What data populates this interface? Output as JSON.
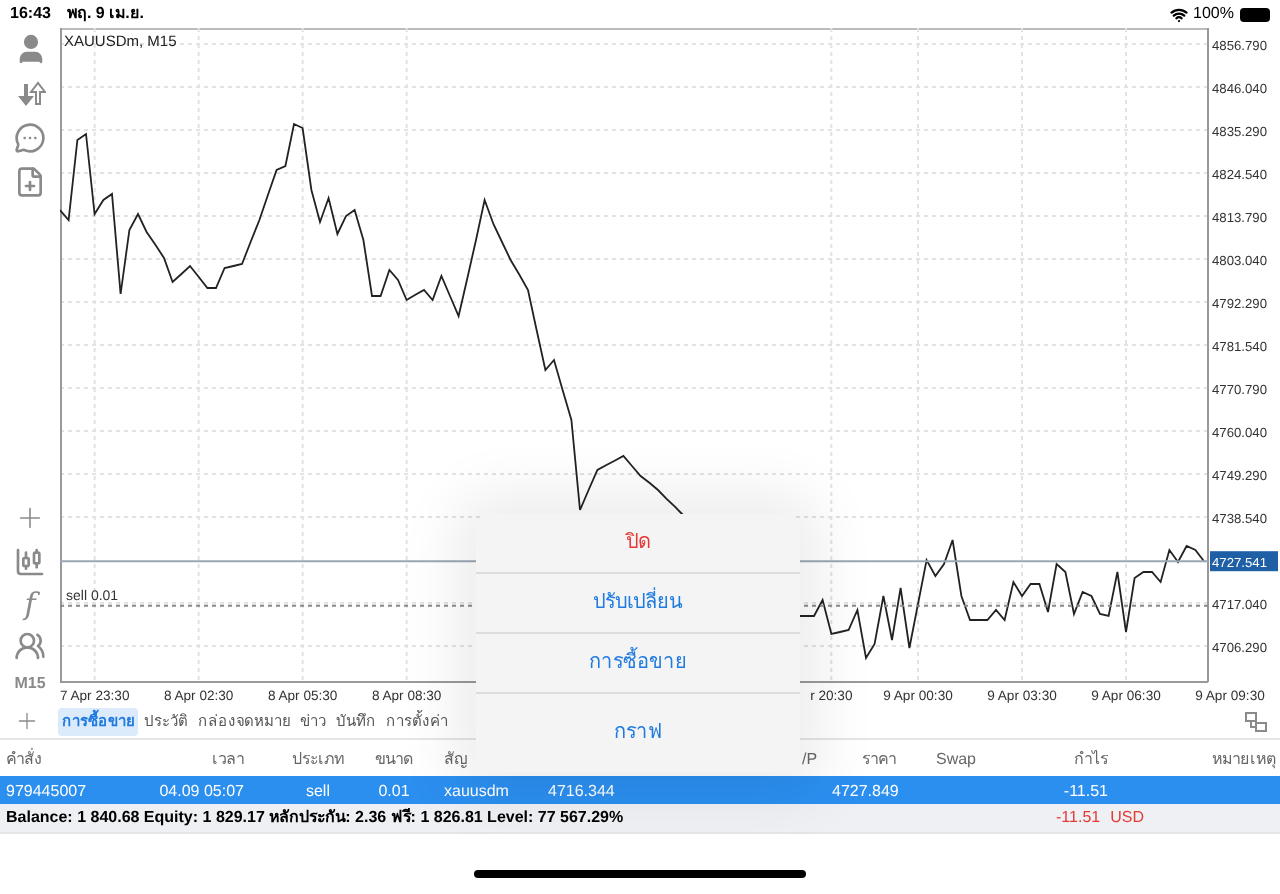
{
  "status_bar": {
    "time": "16:43",
    "date": "พฤ. 9 เม.ย.",
    "battery": "100%"
  },
  "toolbar": {
    "function_label": "f",
    "timeframe": "M15"
  },
  "chart": {
    "title": "XAUUSDm, M15",
    "chart_data": {
      "type": "line",
      "categories": [
        null,
        null,
        null,
        null,
        "7 Apr 23:30",
        null,
        null,
        null,
        null,
        null,
        null,
        null,
        null,
        null,
        null,
        null,
        "8 Apr 02:30",
        null,
        null,
        null,
        null,
        null,
        null,
        null,
        null,
        null,
        null,
        null,
        "8 Apr 05:30",
        null,
        null,
        null,
        null,
        null,
        null,
        null,
        null,
        null,
        null,
        null,
        "8 Apr 08:30",
        null,
        null,
        null,
        null,
        null,
        null,
        null,
        null,
        null,
        null,
        null,
        null,
        null,
        null,
        null,
        null,
        null,
        null,
        null,
        null,
        null,
        null,
        null,
        null,
        null,
        null,
        null,
        null,
        null,
        null,
        null,
        null,
        null,
        null,
        null,
        null,
        null,
        null,
        null,
        null,
        null,
        null,
        null,
        null,
        null,
        null,
        null,
        null,
        "r 20:30",
        null,
        null,
        null,
        null,
        null,
        null,
        null,
        null,
        null,
        "9 Apr 00:30",
        null,
        null,
        null,
        null,
        null,
        null,
        null,
        null,
        null,
        null,
        null,
        "9 Apr 03:30",
        null,
        null,
        null,
        null,
        null,
        null,
        null,
        null,
        null,
        null,
        null,
        "9 Apr 06:30",
        null,
        null,
        null,
        null,
        null,
        null,
        null,
        null,
        null,
        null,
        null,
        "9 Apr 09:30"
      ],
      "series": [
        {
          "color": "#222222",
          "values": [
            4815.3,
            4812.8,
            4832.8,
            4834.3,
            4814.3,
            4817.8,
            4819.3,
            4794.3,
            4810.3,
            4814.3,
            4809.8,
            4806.6,
            4803.3,
            4797.3,
            4799.3,
            4801.3,
            4798.6,
            4795.8,
            4795.8,
            4800.8,
            4801.3,
            4801.8,
            4807.3,
            4812.8,
            4819.1,
            4825.3,
            4826.3,
            4836.8,
            4835.8,
            4820.3,
            4812.3,
            4818.3,
            4809.3,
            4813.8,
            4815.3,
            4807.8,
            4793.8,
            4793.8,
            4800.3,
            4797.8,
            4792.8,
            4794.1,
            4795.3,
            4792.8,
            4798.8,
            4793.8,
            4788.8,
            4798.3,
            4807.8,
            4817.8,
            4811.8,
            4807.3,
            4802.8,
            4799.1,
            4795.3,
            4785.3,
            4775.3,
            4777.8,
            4770.3,
            4762.8,
            4740.3,
            4745.3,
            4750.3,
            4751.5,
            4752.6,
            4753.8,
            4751.3,
            4748.8,
            4747.1,
            4745.3,
            4743.1,
            4741.0,
            4738.8,
            null,
            null,
            null,
            null,
            null,
            null,
            null,
            null,
            null,
            null,
            null,
            null,
            4713.8,
            4713.8,
            4713.8,
            4717.8,
            4709.3,
            4709.8,
            4710.3,
            4715.3,
            4703.3,
            4706.8,
            4718.8,
            4707.8,
            4720.8,
            4705.8,
            4716.8,
            4727.8,
            4723.8,
            4726.8,
            4732.8,
            4718.8,
            4712.8,
            4712.8,
            4712.8,
            4715.3,
            4712.8,
            4722.3,
            4718.8,
            4721.8,
            4721.8,
            4714.8,
            4726.8,
            4724.8,
            4714.3,
            4719.8,
            4718.8,
            4714.3,
            4713.8,
            4724.8,
            4709.8,
            4723.3,
            4724.8,
            4724.8,
            4722.3,
            4730.3,
            4727.3,
            4731.3,
            4730.3,
            4727.5,
            null,
            null,
            null
          ]
        }
      ],
      "ylim": [
        4697.3,
        4860.8
      ],
      "yticks": [
        {
          "value": 4856.79,
          "label": "4856.790"
        },
        {
          "value": 4846.04,
          "label": "4846.040"
        },
        {
          "value": 4835.29,
          "label": "4835.290"
        },
        {
          "value": 4824.54,
          "label": "4824.540"
        },
        {
          "value": 4813.79,
          "label": "4813.790"
        },
        {
          "value": 4803.04,
          "label": "4803.040"
        },
        {
          "value": 4792.29,
          "label": "4792.290"
        },
        {
          "value": 4781.54,
          "label": "4781.540"
        },
        {
          "value": 4770.79,
          "label": "4770.790"
        },
        {
          "value": 4760.04,
          "label": "4760.040"
        },
        {
          "value": 4749.29,
          "label": "4749.290"
        },
        {
          "value": 4738.54,
          "label": "4738.540"
        },
        {
          "value": 4717.04,
          "label": "4717.040"
        },
        {
          "value": 4706.29,
          "label": "4706.290"
        }
      ],
      "grid": true
    },
    "price_tag": "4727.541",
    "order_label": "sell 0.01"
  },
  "action_sheet": {
    "items": [
      {
        "label": "ปิด",
        "kind": "destructive"
      },
      {
        "label": "ปรับเปลี่ยน",
        "kind": "default"
      },
      {
        "label": "การซื้อขาย",
        "kind": "default"
      },
      {
        "label": "กราฟ",
        "kind": "default"
      }
    ]
  },
  "bottom_tabs": [
    {
      "label": "การซื้อขาย",
      "selected": true
    },
    {
      "label": "ประวัติ",
      "selected": false
    },
    {
      "label": "กล่องจดหมาย",
      "selected": false
    },
    {
      "label": "ข่าว",
      "selected": false
    },
    {
      "label": "บันทึก",
      "selected": false
    },
    {
      "label": "การตั้งค่า",
      "selected": false
    }
  ],
  "table": {
    "columns": {
      "order": "คำสั่ง",
      "time": "เวลา",
      "type": "ประเภท",
      "size": "ขนาด",
      "symbol": "สัญ",
      "tp": "/P",
      "price": "ราคา",
      "swap": "Swap",
      "profit": "กำไร",
      "comment": "หมายเหตุ"
    },
    "rows": [
      {
        "selected": true,
        "cells": {
          "order": "979445007",
          "time": "04.09 05:07",
          "type": "sell",
          "size": "0.01",
          "symbol": "xauusdm",
          "open_price": "4716.344",
          "price": "4727.849",
          "profit": "-11.51"
        }
      }
    ]
  },
  "summary": {
    "text": "Balance: 1 840.68 Equity: 1 829.17 หลักประกัน: 2.36 ฟรี: 1 826.81 Level: 77 567.29%",
    "profit": "-11.51",
    "currency": "USD"
  }
}
